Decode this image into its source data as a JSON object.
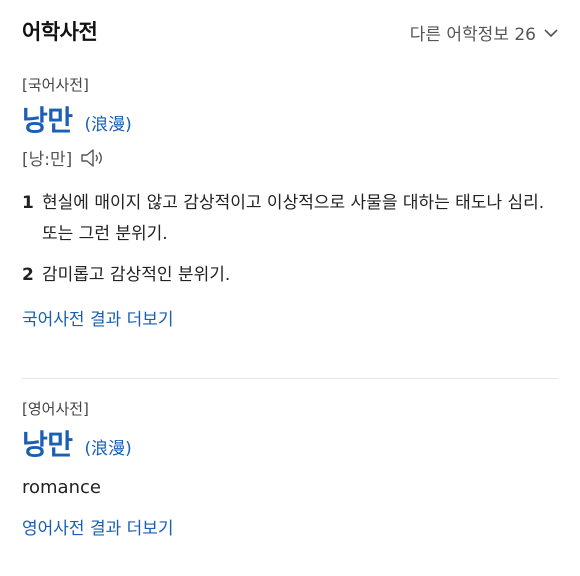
{
  "header": {
    "title": "어학사전",
    "more_link": "다른 어학정보 26"
  },
  "korean": {
    "label": "[국어사전]",
    "word": "낭만",
    "hanja": "(浪漫)",
    "pronunciation": "[낭:만]",
    "definitions": [
      {
        "num": "1",
        "text": "현실에 매이지 않고 감상적이고 이상적으로 사물을 대하는 태도나 심리. 또는 그런 분위기."
      },
      {
        "num": "2",
        "text": "감미롭고 감상적인 분위기."
      }
    ],
    "more": "국어사전 결과 더보기"
  },
  "english": {
    "label": "[영어사전]",
    "word": "낭만",
    "hanja": "(浪漫)",
    "meaning": "romance",
    "more": "영어사전 결과 더보기"
  },
  "colors": {
    "accent": "#1a5fb4",
    "text": "#222222",
    "muted": "#555555",
    "divider": "#e6e6e6"
  },
  "icons": {
    "more": "chevron-down-icon",
    "pronunciation": "speaker-icon"
  }
}
